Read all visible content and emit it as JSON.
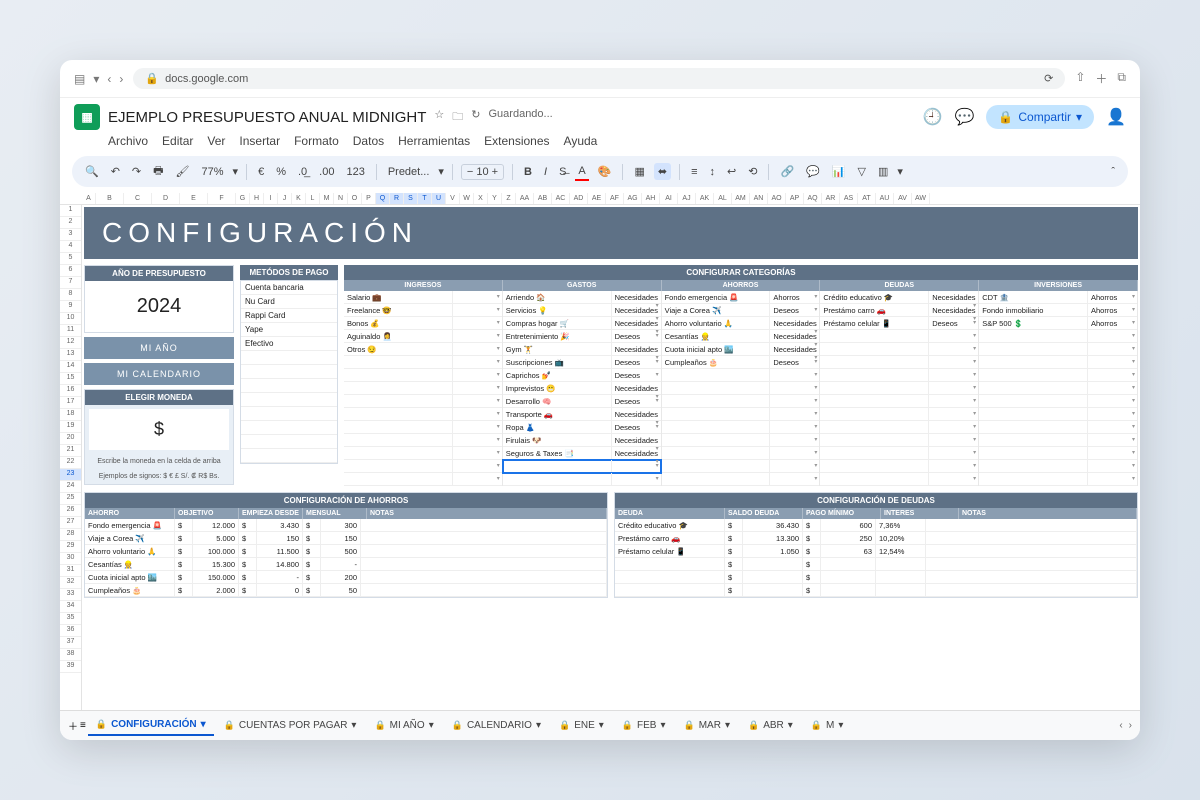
{
  "browser": {
    "url": "docs.google.com"
  },
  "doc": {
    "title": "EJEMPLO PRESUPUESTO ANUAL MIDNIGHT",
    "saving": "Guardando...",
    "share": "Compartir",
    "menus": [
      "Archivo",
      "Editar",
      "Ver",
      "Insertar",
      "Formato",
      "Datos",
      "Herramientas",
      "Extensiones",
      "Ayuda"
    ]
  },
  "toolbar": {
    "zoom": "77%",
    "font": "Predet...",
    "size": "10"
  },
  "cols": [
    "A",
    "B",
    "C",
    "D",
    "E",
    "F",
    "G",
    "H",
    "I",
    "J",
    "K",
    "L",
    "M",
    "N",
    "O",
    "P",
    "Q",
    "R",
    "S",
    "T",
    "U",
    "V",
    "W",
    "X",
    "Y",
    "Z",
    "AA",
    "AB",
    "AC",
    "AD",
    "AE",
    "AF",
    "AG",
    "AH",
    "AI",
    "AJ",
    "AK",
    "AL",
    "AM",
    "AN",
    "AO",
    "AP",
    "AQ",
    "AR",
    "AS",
    "AT",
    "AU",
    "AV",
    "AW"
  ],
  "cols_sel": [
    "Q",
    "R",
    "S",
    "T",
    "U"
  ],
  "rows": [
    "1",
    "2",
    "3",
    "4",
    "5",
    "6",
    "7",
    "8",
    "9",
    "10",
    "11",
    "12",
    "13",
    "14",
    "15",
    "16",
    "17",
    "18",
    "19",
    "20",
    "21",
    "22",
    "23",
    "24",
    "25",
    "26",
    "27",
    "28",
    "29",
    "30",
    "31",
    "32",
    "33",
    "34",
    "35",
    "36",
    "37",
    "38",
    "39"
  ],
  "rows_sel": [
    "23"
  ],
  "sheet": {
    "banner": "CONFIGURACIÓN",
    "year": {
      "hdr": "AÑO DE PRESUPUESTO",
      "val": "2024"
    },
    "buttons": {
      "mi_ano": "MI AÑO",
      "mi_cal": "MI CALENDARIO"
    },
    "currency": {
      "hdr": "ELEGIR MONEDA",
      "val": "$",
      "note1": "Escribe la moneda en la celda de arriba",
      "note2": "Ejemplos de signos: $ € £ S/. ₡ R$ Bs."
    },
    "pay": {
      "hdr": "METÓDOS DE PAGO",
      "items": [
        "Cuenta bancaria",
        "Nu Card",
        "Rappi Card",
        "Yape",
        "Efectivo"
      ]
    },
    "cat": {
      "hdr": "CONFIGURAR CATEGORÍAS",
      "heads": [
        "INGRESOS",
        "GASTOS",
        "AHORROS",
        "DEUDAS",
        "INVERSIONES"
      ],
      "ingresos": [
        [
          "Salario 💼",
          ""
        ],
        [
          "Freelance 🤓",
          ""
        ],
        [
          "Bonos 💰",
          ""
        ],
        [
          "Aguinaldo 👩‍💼",
          ""
        ],
        [
          "Otros 😏",
          ""
        ]
      ],
      "gastos": [
        [
          "Arriendo 🏠",
          "Necesidades"
        ],
        [
          "Servicios 💡",
          "Necesidades"
        ],
        [
          "Compras hogar 🛒",
          "Necesidades"
        ],
        [
          "Entretenimiento 🎉",
          "Deseos"
        ],
        [
          "Gym 🏋️",
          "Necesidades"
        ],
        [
          "Suscripciones 📺",
          "Deseos"
        ],
        [
          "Caprichos 💅",
          "Deseos"
        ],
        [
          "Imprevistos 😬",
          "Necesidades"
        ],
        [
          "Desarrollo 🧠",
          "Deseos"
        ],
        [
          "Transporte 🚗",
          "Necesidades"
        ],
        [
          "Ropa 👗",
          "Deseos"
        ],
        [
          "Firulais 🐶",
          "Necesidades"
        ],
        [
          "Seguros & Taxes 📑",
          "Necesidades"
        ]
      ],
      "ahorros": [
        [
          "Fondo emergencia 🚨",
          "Ahorros"
        ],
        [
          "Viaje a Corea ✈️",
          "Deseos"
        ],
        [
          "Ahorro voluntario 🙏",
          "Necesidades"
        ],
        [
          "Cesantías 👷",
          "Necesidades"
        ],
        [
          "Cuota inicial apto 🏙️",
          "Necesidades"
        ],
        [
          "Cumpleaños 🎂",
          "Deseos"
        ]
      ],
      "deudas": [
        [
          "Crédito educativo 🎓",
          "Necesidades"
        ],
        [
          "Prestámo carro 🚗",
          "Necesidades"
        ],
        [
          "Préstamo celular 📱",
          "Deseos"
        ]
      ],
      "inversiones": [
        [
          "CDT 🏦",
          "Ahorros"
        ],
        [
          "Fondo inmobiliario",
          "Ahorros"
        ],
        [
          "S&P 500 💲",
          "Ahorros"
        ]
      ]
    },
    "savings": {
      "hdr": "CONFIGURACIÓN DE AHORROS",
      "cols": [
        "AHORRO",
        "OBJETIVO",
        "EMPIEZA DESDE",
        "MENSUAL",
        "NOTAS"
      ],
      "rows": [
        [
          "Fondo emergencia 🚨",
          "$",
          "12.000",
          "$",
          "3.430",
          "$",
          "300",
          ""
        ],
        [
          "Viaje a Corea ✈️",
          "$",
          "5.000",
          "$",
          "150",
          "$",
          "150",
          ""
        ],
        [
          "Ahorro voluntario 🙏",
          "$",
          "100.000",
          "$",
          "11.500",
          "$",
          "500",
          ""
        ],
        [
          "Cesantías 👷",
          "$",
          "15.300",
          "$",
          "14.800",
          "$",
          "-",
          ""
        ],
        [
          "Cuota inicial apto 🏙️",
          "$",
          "150.000",
          "$",
          "-",
          "$",
          "200",
          ""
        ],
        [
          "Cumpleaños 🎂",
          "$",
          "2.000",
          "$",
          "0",
          "$",
          "50",
          ""
        ]
      ]
    },
    "debts": {
      "hdr": "CONFIGURACIÓN DE DEUDAS",
      "cols": [
        "DEUDA",
        "SALDO DEUDA",
        "PAGO MÍNIMO",
        "INTERES",
        "NOTAS"
      ],
      "rows": [
        [
          "Crédito educativo 🎓",
          "$",
          "36.430",
          "$",
          "600",
          "7,36%",
          ""
        ],
        [
          "Prestámo carro 🚗",
          "$",
          "13.300",
          "$",
          "250",
          "10,20%",
          ""
        ],
        [
          "Préstamo celular 📱",
          "$",
          "1.050",
          "$",
          "63",
          "12,54%",
          ""
        ]
      ]
    }
  },
  "tabs": [
    "CONFIGURACIÓN",
    "CUENTAS POR PAGAR",
    "MI AÑO",
    "CALENDARIO",
    "ENE",
    "FEB",
    "MAR",
    "ABR",
    "M"
  ]
}
